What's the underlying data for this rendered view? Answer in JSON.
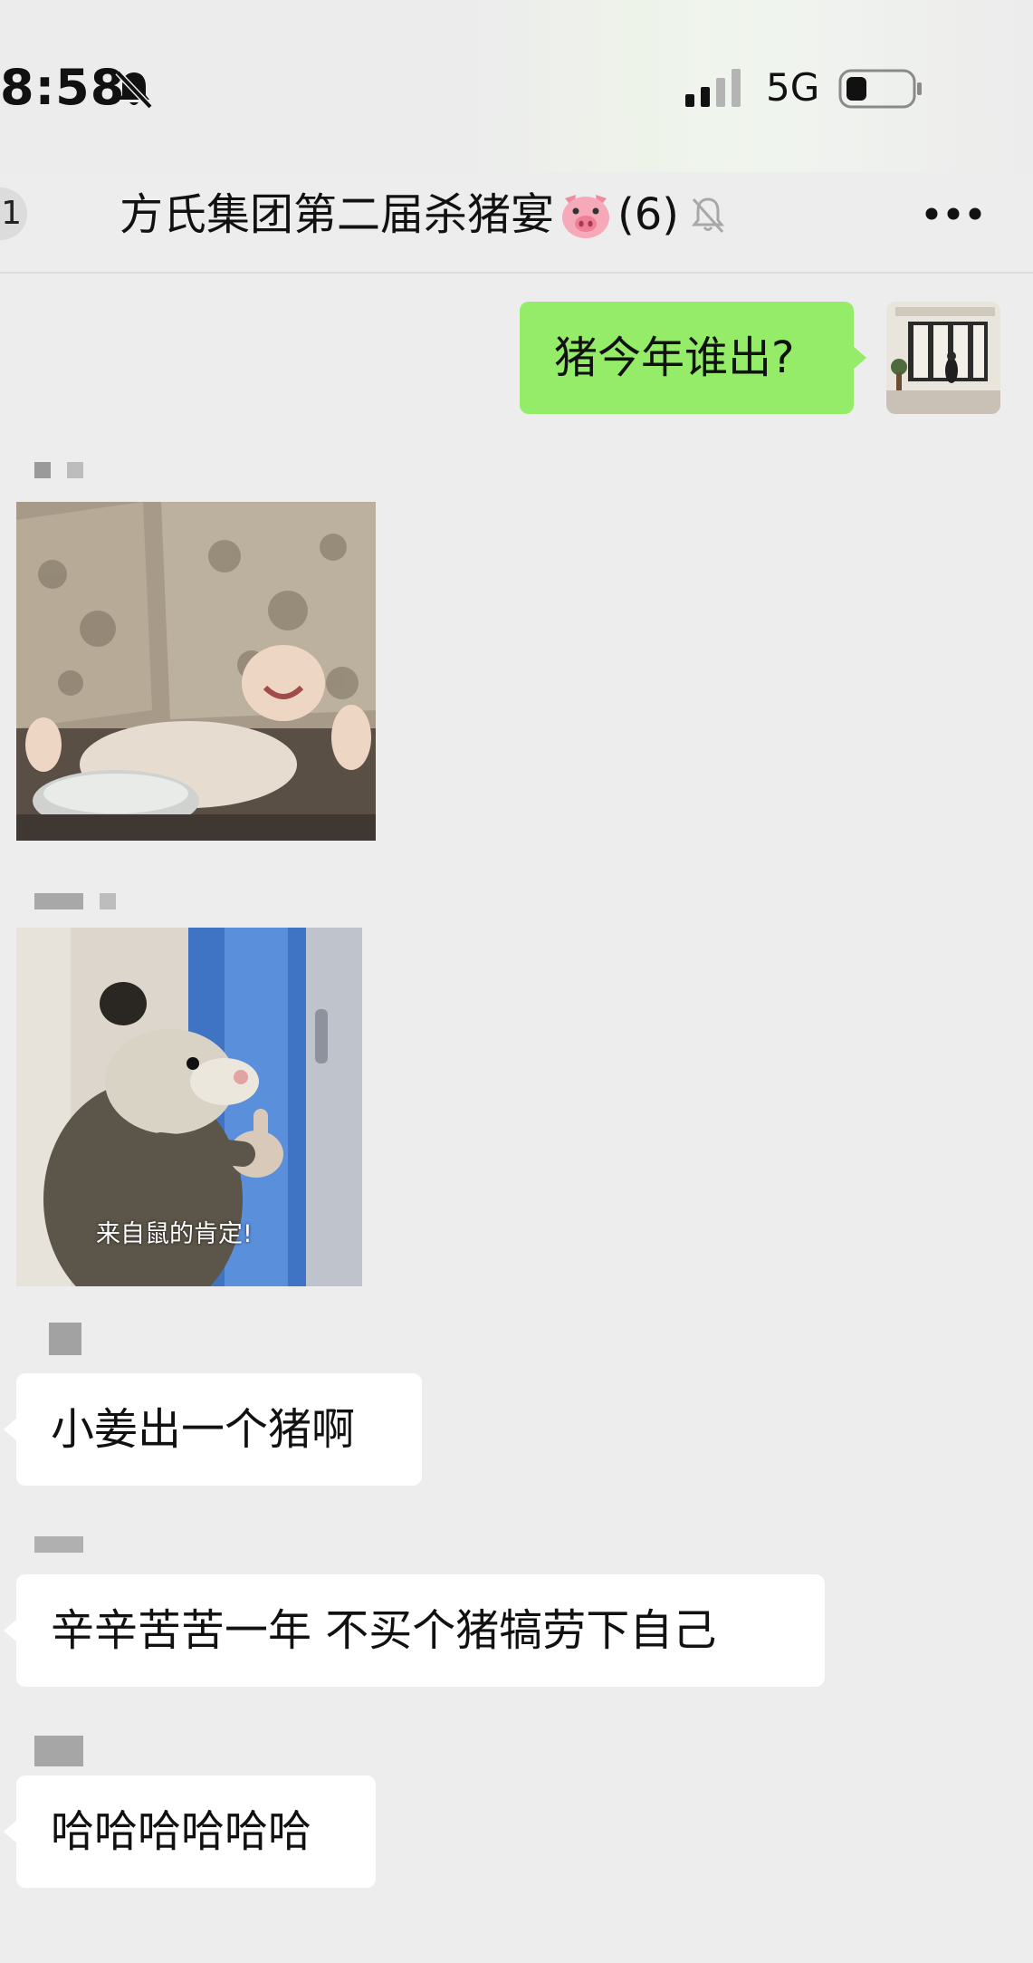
{
  "status_bar": {
    "time": "8:58",
    "network": "5G",
    "icons": [
      "bell-off-icon",
      "signal-icon",
      "battery-icon"
    ]
  },
  "header": {
    "back_badge": "1",
    "title": "方氏集团第二届杀猪宴",
    "title_emoji": "pig-face-icon",
    "member_count": "(6)",
    "muted_icon": "bell-off-icon",
    "more_icon": "more-icon"
  },
  "messages": [
    {
      "direction": "outgoing",
      "type": "text",
      "text": "猪今年谁出?"
    },
    {
      "direction": "incoming",
      "type": "sticker",
      "sticker": "laughing-baby-sticker"
    },
    {
      "direction": "incoming",
      "type": "sticker",
      "sticker": "opossum-thumbs-up-sticker",
      "caption": "来自鼠的肯定!"
    },
    {
      "direction": "incoming",
      "type": "text",
      "text": "小姜出一个猪啊"
    },
    {
      "direction": "incoming",
      "type": "text",
      "text": "辛辛苦苦一年 不买个猪犒劳下自己"
    },
    {
      "direction": "incoming",
      "type": "text",
      "text": "哈哈哈哈哈哈"
    }
  ],
  "colors": {
    "background": "#ededed",
    "outgoing_bubble": "#95ec69",
    "incoming_bubble": "#ffffff"
  }
}
